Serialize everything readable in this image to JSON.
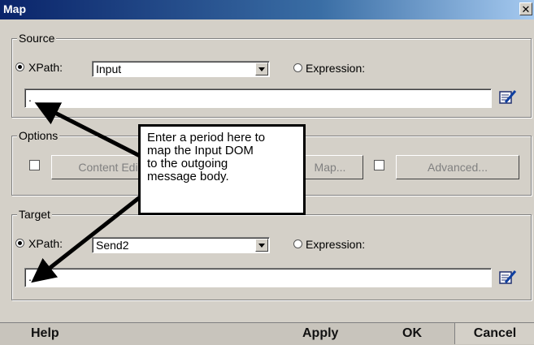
{
  "window": {
    "title": "Map",
    "close": "✕"
  },
  "source": {
    "legend": "Source",
    "xpath_label": "XPath:",
    "xpath_value": "Input",
    "expression_label": "Expression:",
    "text_value": "."
  },
  "options": {
    "legend": "Options",
    "content_editor_label": "Content Edi",
    "map_label": "Map...",
    "advanced_label": "Advanced..."
  },
  "target": {
    "legend": "Target",
    "xpath_label": "XPath:",
    "xpath_value": "Send2",
    "expression_label": "Expression:",
    "text_value": "."
  },
  "callout": {
    "line1": "Enter a period here to",
    "line2": "map the Input DOM",
    "line3": "to the outgoing",
    "line4": "message body."
  },
  "footer": {
    "help": "Help",
    "apply": "Apply",
    "ok": "OK",
    "cancel": "Cancel"
  },
  "icons": {
    "edit": "edit-pencil-icon",
    "arrow": "black-arrow"
  }
}
